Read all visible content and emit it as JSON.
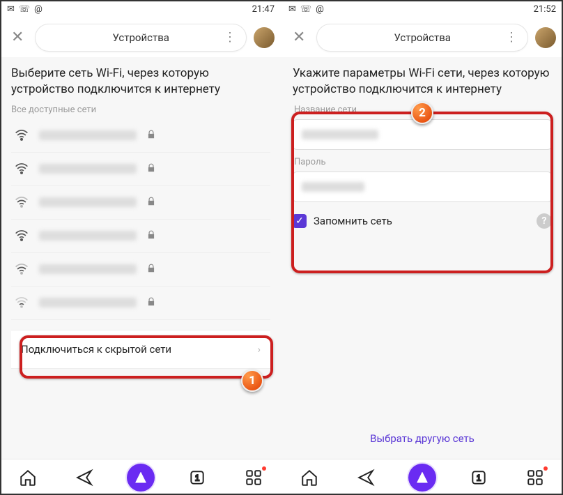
{
  "left": {
    "status": {
      "time": "21:47"
    },
    "header": {
      "title": "Устройства"
    },
    "heading": "Выберите сеть Wi-Fi, через которую устройство подключится к интернету",
    "subheading": "Все доступные сети",
    "networks": [
      {
        "strength": "full",
        "locked": true
      },
      {
        "strength": "full",
        "locked": true
      },
      {
        "strength": "mid",
        "locked": true
      },
      {
        "strength": "full",
        "locked": true
      },
      {
        "strength": "mid",
        "locked": true
      },
      {
        "strength": "low",
        "locked": true
      }
    ],
    "hidden_network_label": "Подключиться к скрытой сети",
    "badge": "1"
  },
  "right": {
    "status": {
      "time": "21:52"
    },
    "header": {
      "title": "Устройства"
    },
    "heading": "Укажите параметры Wi-Fi сети, через которую устройство подключится к интернету",
    "field_ssid_label": "Название сети",
    "field_pwd_label": "Пароль",
    "remember_label": "Запомнить сеть",
    "bottom_link_label": "Выбрать другую сеть",
    "badge": "2"
  }
}
